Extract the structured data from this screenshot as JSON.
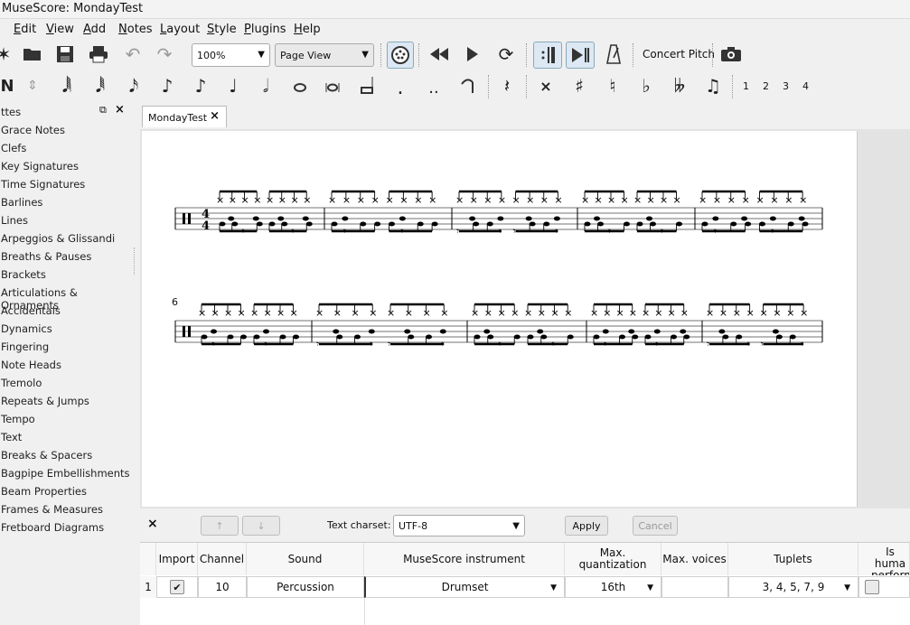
{
  "window": {
    "title": "MuseScore: MondayTest"
  },
  "menu": {
    "edit": {
      "u": "E",
      "rest": "dit"
    },
    "view": {
      "u": "V",
      "rest": "iew"
    },
    "add": {
      "u": "A",
      "rest": "dd"
    },
    "notes": {
      "u": "N",
      "rest": "otes"
    },
    "layout": {
      "u": "L",
      "rest": "ayout"
    },
    "style": {
      "u": "S",
      "rest": "tyle"
    },
    "plugins": {
      "u": "P",
      "rest": "lugins"
    },
    "help": {
      "u": "H",
      "rest": "elp"
    }
  },
  "toolbar": {
    "zoom": "100%",
    "view_mode": "Page View",
    "concert_pitch": "Concert Pitch",
    "voices": [
      "1",
      "2",
      "3",
      "4"
    ]
  },
  "palette": {
    "title_fragment": "ttes",
    "items": [
      "Grace Notes",
      "Clefs",
      "Key Signatures",
      "Time Signatures",
      "Barlines",
      "Lines",
      "Arpeggios & Glissandi",
      "Breaths & Pauses",
      "Brackets",
      "Articulations & Ornaments",
      "Accidentals",
      "Dynamics",
      "Fingering",
      "Note Heads",
      "Tremolo",
      "Repeats & Jumps",
      "Tempo",
      "Text",
      "Breaks & Spacers",
      "Bagpipe Embellishments",
      "Beam Properties",
      "Frames & Measures",
      "Fretboard Diagrams"
    ]
  },
  "score": {
    "tab_label": "MondayTest",
    "time_sig_top": "4",
    "time_sig_bottom": "4",
    "system2_measure_number": "6"
  },
  "import": {
    "charset_label": "Text charset:",
    "charset_value": "UTF-8",
    "apply_label": "Apply",
    "cancel_label": "Cancel",
    "up_arrow": "↑",
    "down_arrow": "↓",
    "close_glyph": "×"
  },
  "table": {
    "headers": {
      "import": "Import",
      "channel": "Channel",
      "sound": "Sound",
      "instrument": "MuseScore instrument",
      "quant": "Max. quantization",
      "voices": "Max. voices",
      "tuplets": "Tuplets",
      "human1": "Is huma",
      "human2": "performa"
    },
    "row": {
      "index": "1",
      "channel": "10",
      "sound": "Percussion",
      "instrument": "Drumset",
      "quant": "16th",
      "voices": "",
      "tuplets": "3, 4, 5, 7, 9"
    }
  }
}
